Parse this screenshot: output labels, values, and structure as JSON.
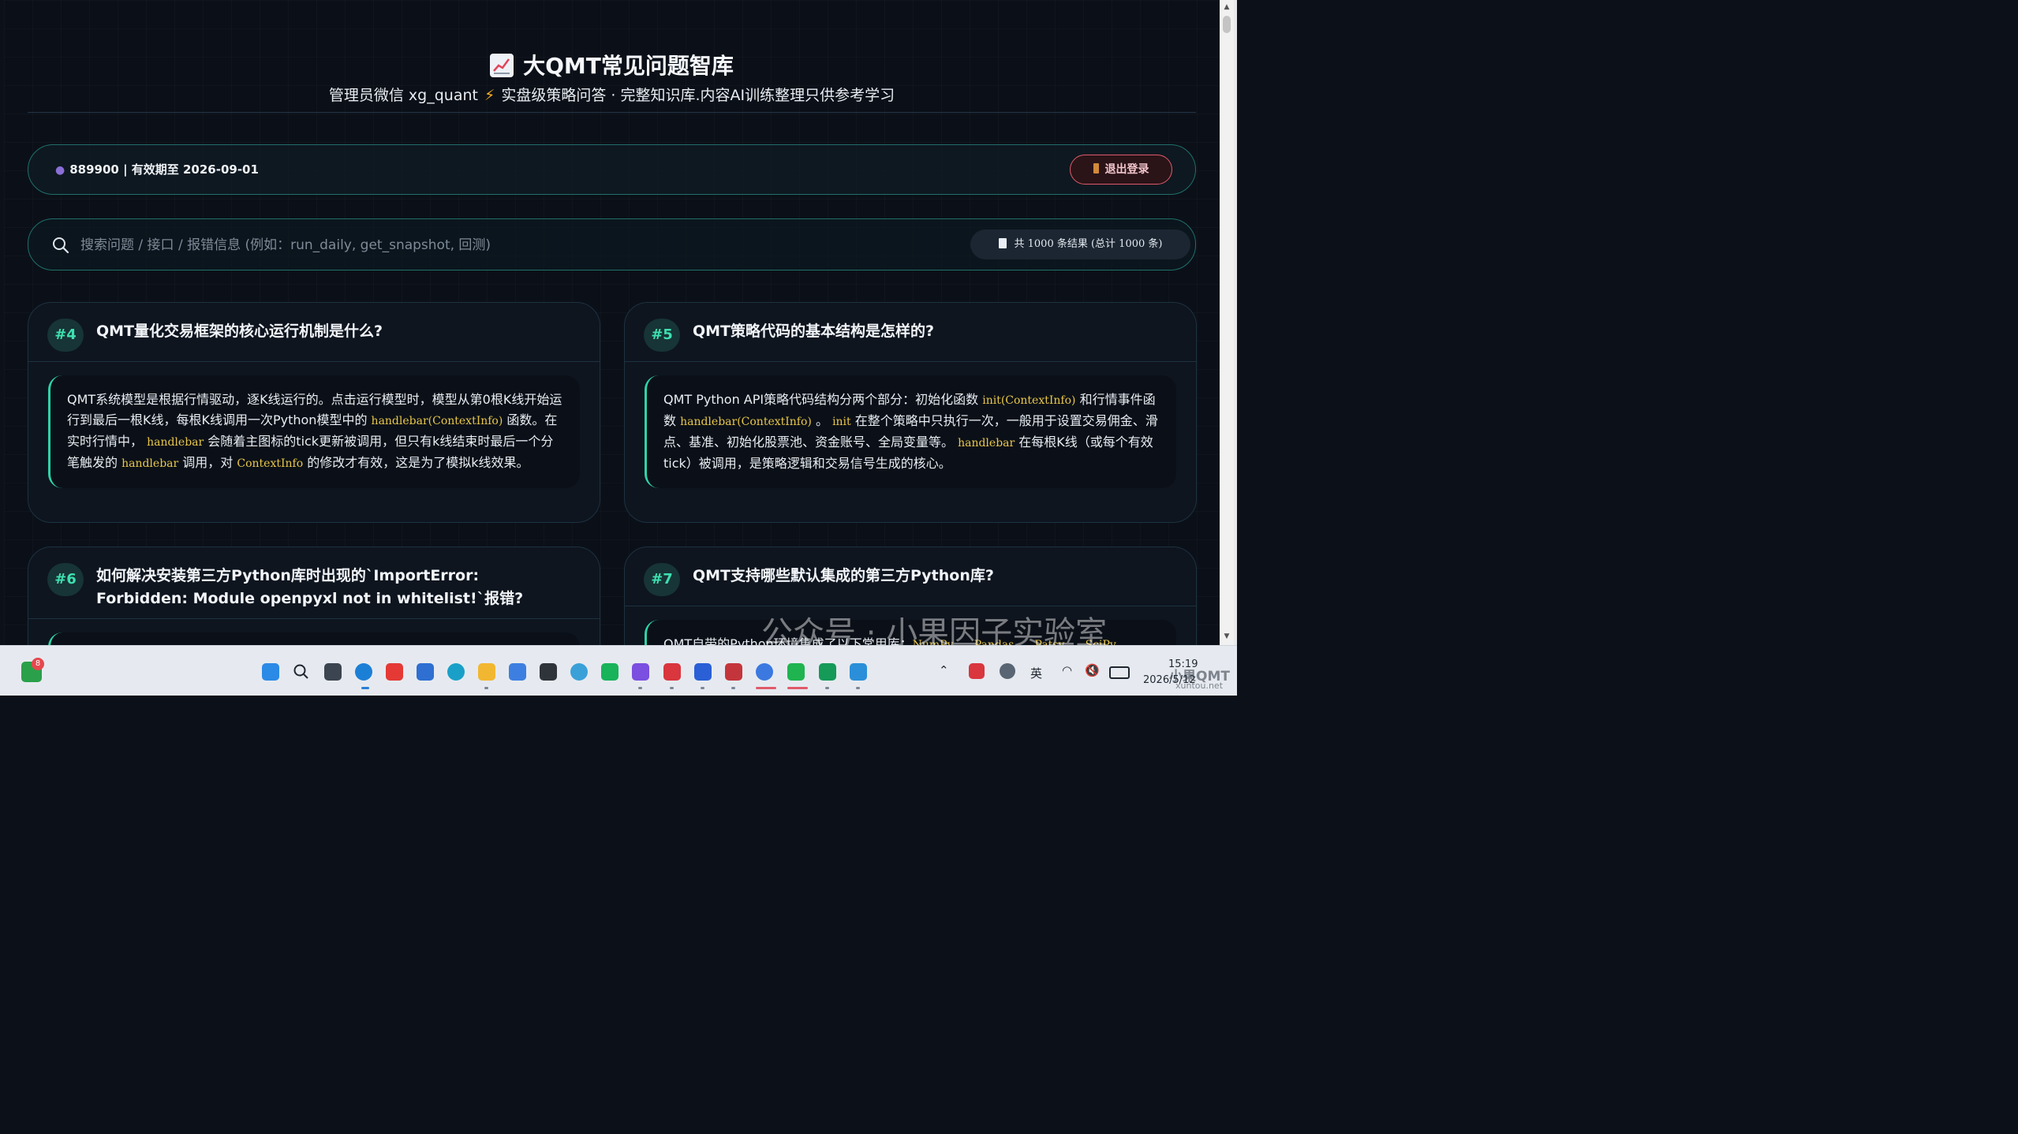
{
  "header": {
    "title": "大QMT常见问题智库",
    "subtitle_left": "管理员微信 xg_quant",
    "subtitle_right": "实盘级策略问答 · 完整知识库.内容AI训练整理只供参考学习"
  },
  "user": {
    "info": "889900 | 有效期至 2026-09-01",
    "logout_label": "退出登录"
  },
  "search": {
    "placeholder": "搜索问题 / 接口 / 报错信息 (例如：run_daily, get_snapshot, 回测)",
    "value": "",
    "count_text": "共 1000 条结果 (总计 1000 条)"
  },
  "cards": [
    {
      "number": "#4",
      "title": "QMT量化交易框架的核心运行机制是什么?",
      "answer": [
        {
          "t": "QMT系统模型是根据行情驱动，逐K线运行的。点击运行模型时，模型从第0根K线开始运行到最后一根K线，每根K线调用一次Python模型中的 "
        },
        {
          "c": "handlebar(ContextInfo)"
        },
        {
          "t": " 函数。在实时行情中， "
        },
        {
          "c": "handlebar"
        },
        {
          "t": " 会随着主图标的tick更新被调用，但只有k线结束时最后一个分笔触发的 "
        },
        {
          "c": "handlebar"
        },
        {
          "t": " 调用，对 "
        },
        {
          "c": "ContextInfo"
        },
        {
          "t": " 的修改才有效，这是为了模拟k线效果。"
        }
      ]
    },
    {
      "number": "#5",
      "title": "QMT策略代码的基本结构是怎样的?",
      "answer": [
        {
          "t": "QMT Python API策略代码结构分两个部分：初始化函数 "
        },
        {
          "c": "init(ContextInfo)"
        },
        {
          "t": " 和行情事件函数 "
        },
        {
          "c": "handlebar(ContextInfo)"
        },
        {
          "t": " 。 "
        },
        {
          "c": "init"
        },
        {
          "t": " 在整个策略中只执行一次，一般用于设置交易佣金、滑点、基准、初始化股票池、资金账号、全局变量等。 "
        },
        {
          "c": "handlebar"
        },
        {
          "t": " 在每根K线（或每个有效tick）被调用，是策略逻辑和交易信号生成的核心。"
        }
      ]
    },
    {
      "number": "#6",
      "title": "如何解决安装第三方Python库时出现的`ImportError: Forbidden: Module openpyxl not in whitelist!`报错?",
      "answer": []
    },
    {
      "number": "#7",
      "title": "QMT支持哪些默认集成的第三方Python库?",
      "answer": [
        {
          "t": "QMT自带的Python环境集成了以下常用库："
        },
        {
          "c": "NumPy"
        },
        {
          "t": " 、 "
        },
        {
          "c": "Pandas"
        },
        {
          "t": " 、 "
        },
        {
          "c": "Patsy"
        },
        {
          "t": " 、 "
        },
        {
          "c": "SciPy"
        }
      ]
    }
  ],
  "watermark": {
    "text": "公众号 · 小果因子实验室",
    "site_line1": "小果QMT",
    "site_line2": "xuntou.net"
  },
  "taskbar": {
    "notification_count": "8",
    "ime_label": "英",
    "time": "15:19",
    "date": "2026/5/12"
  },
  "colors": {
    "accent": "#2dd4a8",
    "code": "#e8c74a",
    "logout_border": "#e05a6a",
    "background": "#0b1018"
  }
}
